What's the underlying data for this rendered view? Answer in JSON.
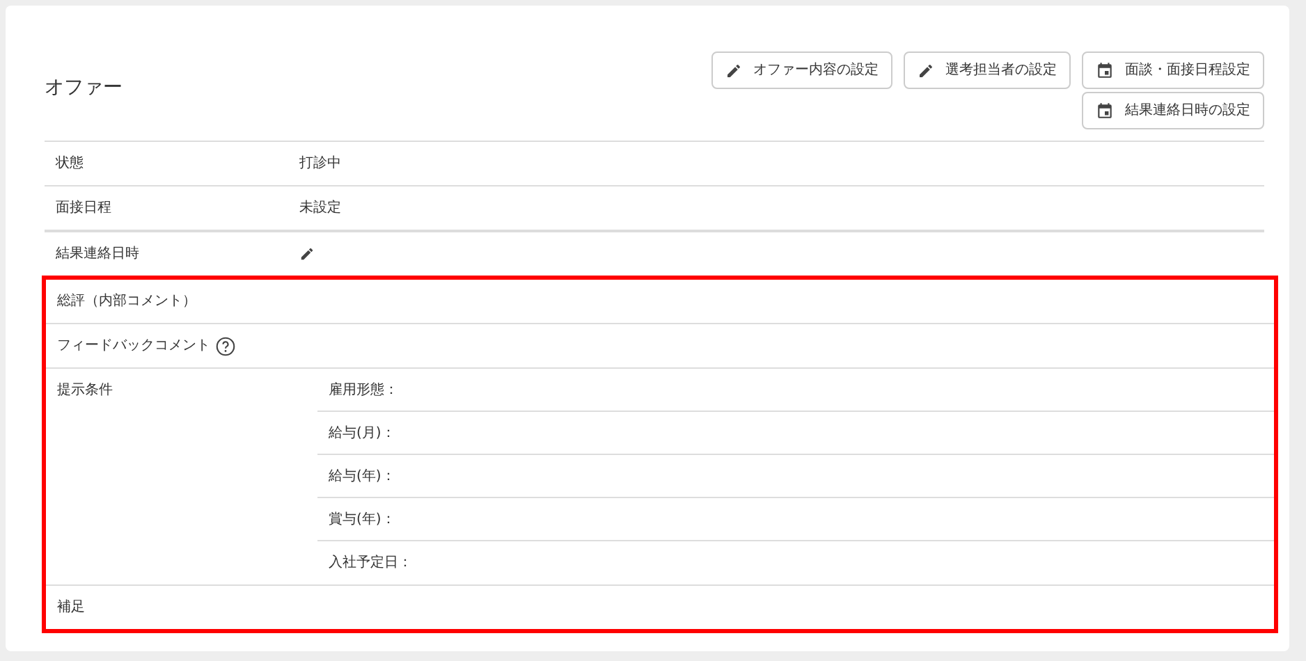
{
  "section": {
    "title": "オファー"
  },
  "toolbar": {
    "row_1": [
      {
        "label": "オファー内容の設定",
        "kind": "edit"
      },
      {
        "label": "選考担当者の設定",
        "kind": "edit"
      },
      {
        "label": "面談・面接日程設定",
        "kind": "calendar"
      }
    ],
    "row_2": [
      {
        "label": "結果連絡日時の設定",
        "kind": "calendar"
      }
    ]
  },
  "rows": [
    {
      "label": "状態",
      "kind": "text",
      "value": "打診中",
      "highlighted": false
    },
    {
      "label": "面接日程",
      "kind": "text",
      "value": "未設定",
      "highlighted": false
    },
    {
      "label": "結果連絡日時",
      "kind": "edit",
      "highlighted": false
    },
    {
      "label": "総評（内部コメント）",
      "kind": "text",
      "highlighted": true
    },
    {
      "label": "フィードバックコメント",
      "kind": "help",
      "highlighted": true
    },
    {
      "label": "提示条件",
      "kind": "group",
      "items": [
        "雇用形態：",
        "給与(月)：",
        "給与(年)：",
        "賞与(年)：",
        "入社予定日："
      ],
      "highlighted": true
    },
    {
      "label": "補足",
      "kind": "text",
      "highlighted": true
    }
  ]
}
